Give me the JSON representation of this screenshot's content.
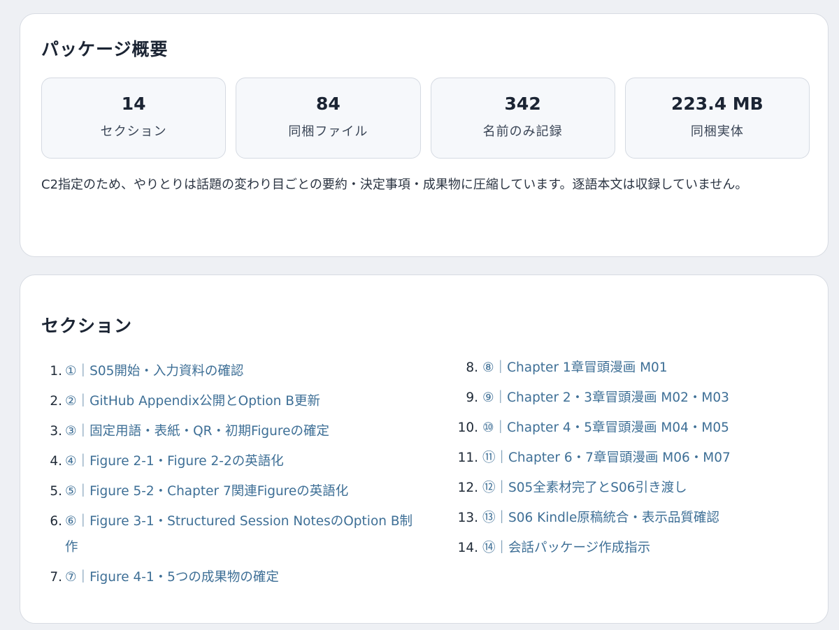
{
  "overview": {
    "title": "パッケージ概要",
    "stats": [
      {
        "value": "14",
        "label": "セクション"
      },
      {
        "value": "84",
        "label": "同梱ファイル"
      },
      {
        "value": "342",
        "label": "名前のみ記録"
      },
      {
        "value": "223.4 MB",
        "label": "同梱実体"
      }
    ],
    "note": "C2指定のため、やりとりは話題の変わり目ごとの要約・決定事項・成果物に圧縮しています。逐語本文は収録していません。"
  },
  "sections": {
    "title": "セクション",
    "items": [
      {
        "num": "1.",
        "label": "①｜S05開始・入力資料の確認"
      },
      {
        "num": "2.",
        "label": "②｜GitHub Appendix公開とOption B更新"
      },
      {
        "num": "3.",
        "label": "③｜固定用語・表紙・QR・初期Figureの確定"
      },
      {
        "num": "4.",
        "label": "④｜Figure 2-1・Figure 2-2の英語化"
      },
      {
        "num": "5.",
        "label": "⑤｜Figure 5-2・Chapter 7関連Figureの英語化"
      },
      {
        "num": "6.",
        "label": "⑥｜Figure 3-1・Structured Session NotesのOption B制作"
      },
      {
        "num": "7.",
        "label": "⑦｜Figure 4-1・5つの成果物の確定"
      },
      {
        "num": "8.",
        "label": "⑧｜Chapter 1章冒頭漫画 M01"
      },
      {
        "num": "9.",
        "label": "⑨｜Chapter 2・3章冒頭漫画 M02・M03"
      },
      {
        "num": "10.",
        "label": "⑩｜Chapter 4・5章冒頭漫画 M04・M05"
      },
      {
        "num": "11.",
        "label": "⑪｜Chapter 6・7章冒頭漫画 M06・M07"
      },
      {
        "num": "12.",
        "label": "⑫｜S05全素材完了とS06引き渡し"
      },
      {
        "num": "13.",
        "label": "⑬｜S06 Kindle原稿統合・表示品質確認"
      },
      {
        "num": "14.",
        "label": "⑭｜会話パッケージ作成指示"
      }
    ]
  }
}
